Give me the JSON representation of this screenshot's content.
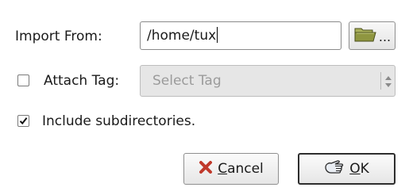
{
  "import_from": {
    "label": "Import From:",
    "path_value": "/home/tux",
    "browse_ellipsis": "..."
  },
  "attach_tag": {
    "label": "Attach Tag:",
    "checked": false,
    "select_placeholder": "Select Tag",
    "enabled": false
  },
  "include_subdirs": {
    "label": "Include subdirectories.",
    "checked": true
  },
  "buttons": {
    "cancel": {
      "mnemonic": "C",
      "rest": "ancel",
      "icon": "cancel-x-icon"
    },
    "ok": {
      "mnemonic": "O",
      "rest": "K",
      "icon": "ok-hand-icon"
    }
  },
  "colors": {
    "cancel_icon": "#c0392b",
    "folder_icon": "#7f8a3a",
    "disabled_text": "#9b9b9b"
  }
}
